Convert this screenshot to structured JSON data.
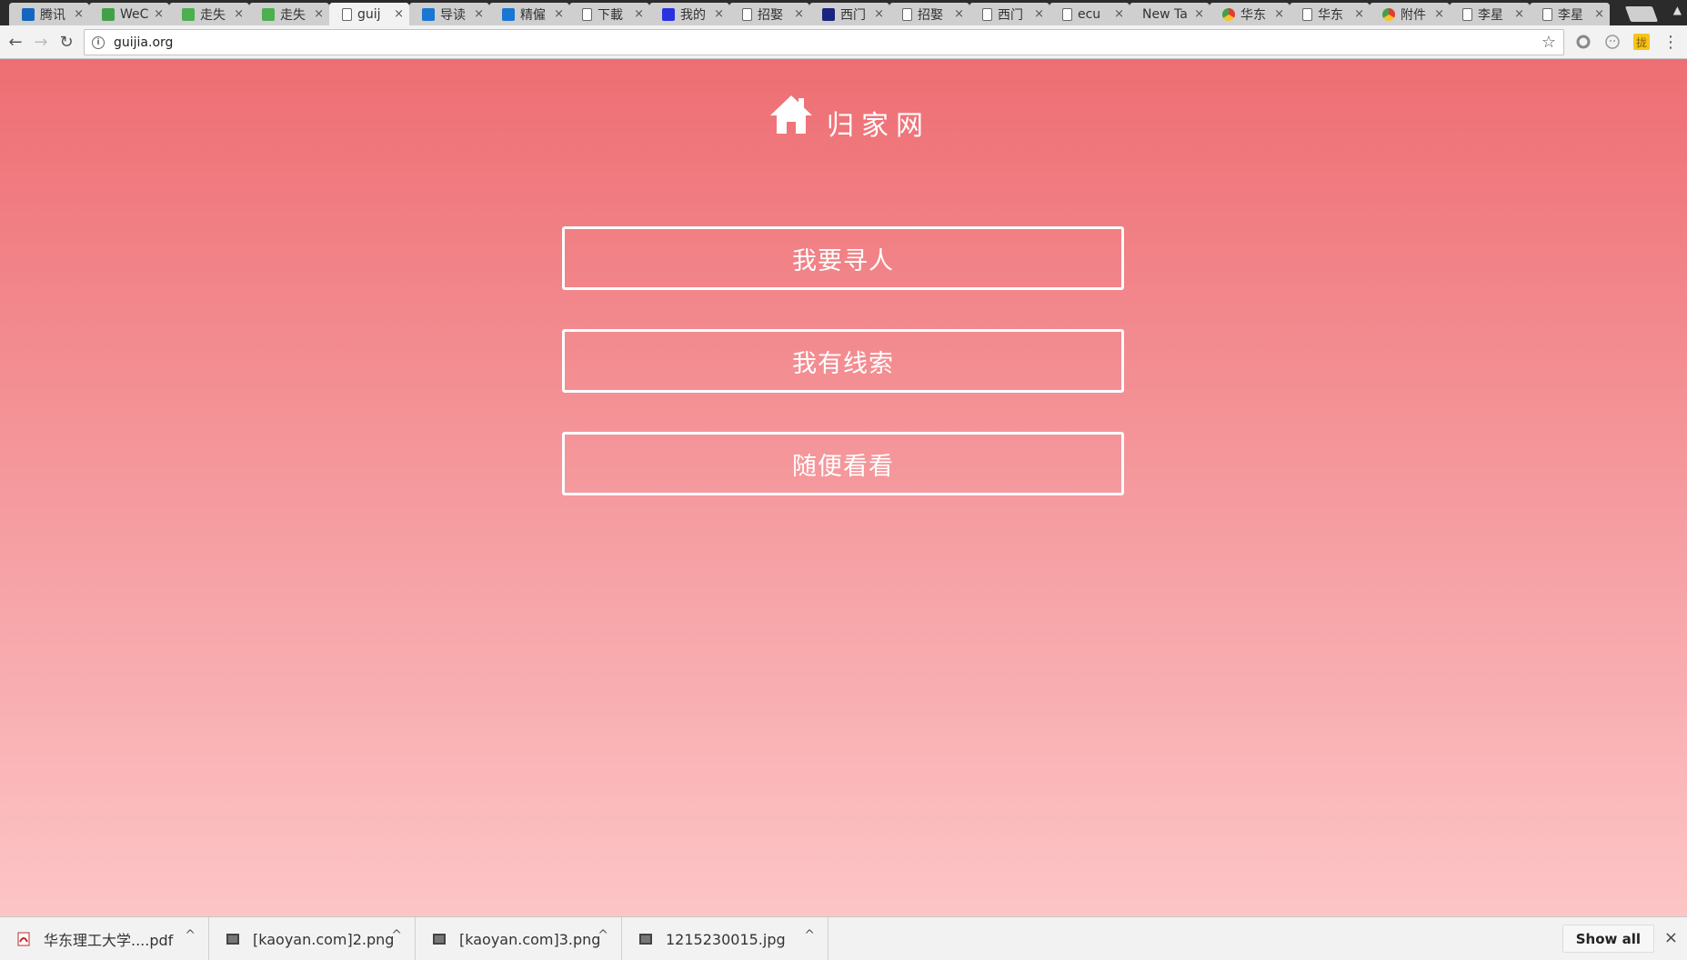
{
  "browser": {
    "tabs": [
      {
        "title": "腾讯",
        "favicon": "qq-mail-icon",
        "color": "#1565c0"
      },
      {
        "title": "WeC",
        "favicon": "wechat-web-icon",
        "color": "#43a047"
      },
      {
        "title": "走失",
        "favicon": "wechat-icon",
        "color": "#4caf50"
      },
      {
        "title": "走失",
        "favicon": "wechat-icon",
        "color": "#4caf50"
      },
      {
        "title": "guij",
        "favicon": "page-icon",
        "color": "#666666"
      },
      {
        "title": "导读",
        "favicon": "k-icon",
        "color": "#1976d2"
      },
      {
        "title": "精僱",
        "favicon": "k-icon",
        "color": "#1976d2"
      },
      {
        "title": "下載",
        "favicon": "page-icon",
        "color": "#666666"
      },
      {
        "title": "我的",
        "favicon": "baidu-icon",
        "color": "#2932e1"
      },
      {
        "title": "招娶",
        "favicon": "page-icon",
        "color": "#666666"
      },
      {
        "title": "西门",
        "favicon": "crown-icon",
        "color": "#1a237e"
      },
      {
        "title": "招娶",
        "favicon": "page-icon",
        "color": "#666666"
      },
      {
        "title": "西门",
        "favicon": "page-icon",
        "color": "#666666"
      },
      {
        "title": "ecu",
        "favicon": "page-icon",
        "color": "#666666"
      },
      {
        "title": "New Ta",
        "favicon": "none",
        "color": "#666666"
      },
      {
        "title": "华东",
        "favicon": "chrome-icon",
        "color": "#e53935"
      },
      {
        "title": "华东",
        "favicon": "page-icon",
        "color": "#666666"
      },
      {
        "title": "附件",
        "favicon": "chrome-icon",
        "color": "#e53935"
      },
      {
        "title": "李星",
        "favicon": "page-icon",
        "color": "#666666"
      },
      {
        "title": "李星",
        "favicon": "page-icon",
        "color": "#666666"
      }
    ],
    "active_tab": 4,
    "tab_close": "×",
    "url": "guijia.org",
    "info": "i",
    "back": "←",
    "forward": "→",
    "reload": "↻",
    "star": "☆",
    "menu": "⋮",
    "ext_label": "拢"
  },
  "page": {
    "site_name": "归家网",
    "background_top": "#ee6e73",
    "background_bottom": "#fdc5c6",
    "buttons": [
      {
        "label": "我要寻人"
      },
      {
        "label": "我有线索"
      },
      {
        "label": "随便看看"
      }
    ]
  },
  "downloads": {
    "items": [
      {
        "name": "华东理工大学....pdf",
        "icon": "pdf-icon"
      },
      {
        "name": "[kaoyan.com]2.png",
        "icon": "image-file-icon"
      },
      {
        "name": "[kaoyan.com]3.png",
        "icon": "image-file-icon"
      },
      {
        "name": "1215230015.jpg",
        "icon": "image-file-icon"
      }
    ],
    "caret": "^",
    "show_all": "Show all",
    "close": "×"
  }
}
